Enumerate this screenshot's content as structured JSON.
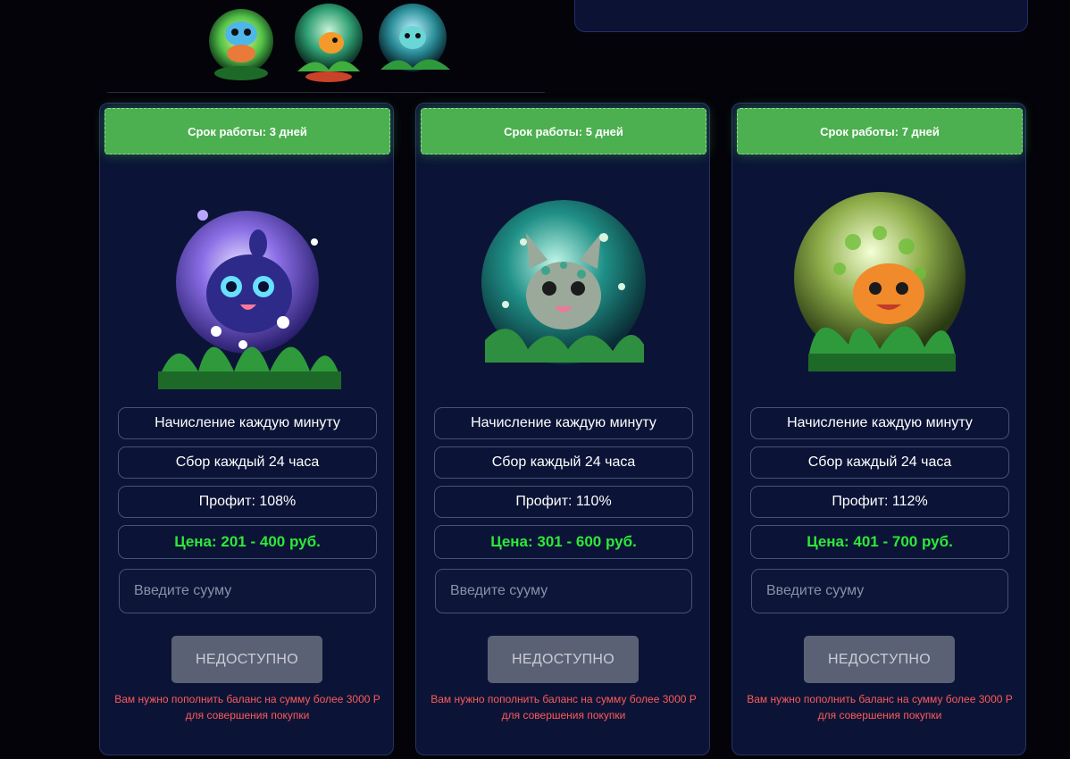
{
  "colors": {
    "background": "#030309",
    "card_bg": "#0b1436",
    "header_green": "#4caf50",
    "price_green": "#2ee83a",
    "warning_red": "#ff5a5a",
    "button_disabled": "#5b6174"
  },
  "plans": [
    {
      "header": "Срок работы: 3 дней",
      "creature_icon": "purple-bubble-creature-icon",
      "accrual": "Начисление каждую минуту",
      "collection": "Сбор каждый 24 часа",
      "profit": "Профит: 108%",
      "price": "Цена: 201 - 400 руб.",
      "amount_placeholder": "Введите сууму",
      "button_label": "НЕДОСТУПНО",
      "warning": "Вам нужно пополнить баланс на сумму более 3000 Р для совершения покупки"
    },
    {
      "header": "Срок работы: 5 дней",
      "creature_icon": "teal-bubble-creature-icon",
      "accrual": "Начисление каждую минуту",
      "collection": "Сбор каждый 24 часа",
      "profit": "Профит: 110%",
      "price": "Цена: 301 - 600 руб.",
      "amount_placeholder": "Введите сууму",
      "button_label": "НЕДОСТУПНО",
      "warning": "Вам нужно пополнить баланс на сумму более 3000 Р для совершения покупки"
    },
    {
      "header": "Срок работы: 7 дней",
      "creature_icon": "orange-bubble-creature-icon",
      "accrual": "Начисление каждую минуту",
      "collection": "Сбор каждый 24 часа",
      "profit": "Профит: 112%",
      "price": "Цена: 401 - 700 руб.",
      "amount_placeholder": "Введите сууму",
      "button_label": "НЕДОСТУПНО",
      "warning": "Вам нужно пополнить баланс на сумму более 3000 Р для совершения покупки"
    }
  ]
}
